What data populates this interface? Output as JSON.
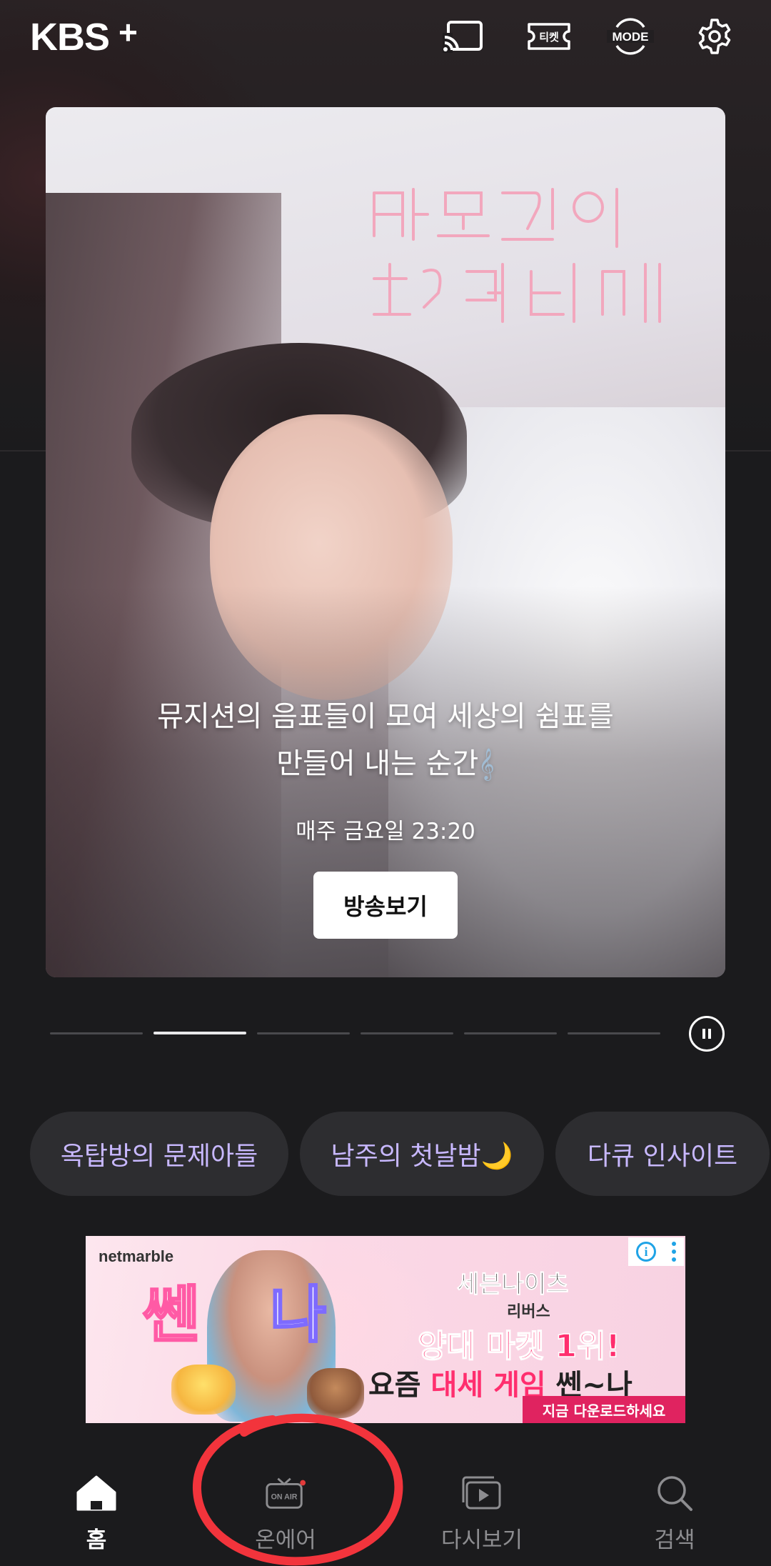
{
  "header": {
    "logo_text": "KBS",
    "logo_plus": "+",
    "icons": [
      "cast-icon",
      "ticket-icon",
      "mode-icon",
      "settings-icon"
    ],
    "ticket_label": "티켓",
    "mode_label": "MODE"
  },
  "hero": {
    "description_line1": "뮤지션의 음표들이 모여 세상의 쉼표를",
    "description_line2": "만들어 내는 순간",
    "schedule": "매주 금요일 23:20",
    "watch_button": "방송보기",
    "slide_count": 6,
    "active_slide": 2
  },
  "chips": [
    {
      "label": "옥탑방의 문제아들"
    },
    {
      "label": "남주의 첫날밤🌙"
    },
    {
      "label": "다큐 인사이트"
    }
  ],
  "ad": {
    "brand": "netmarble",
    "title": "세븐나이츠",
    "subtitle": "리버스",
    "rank_text": "양대 마켓 1위!",
    "slogan_prefix": "요즘",
    "slogan_highlight": "대세 게임",
    "slogan_suffix": "쎈~나",
    "cta": "지금 다운로드하세요",
    "info_icon": "info-icon"
  },
  "bottom_nav": [
    {
      "label": "홈",
      "icon": "home-icon",
      "active": true
    },
    {
      "label": "온에어",
      "icon": "on-air-icon",
      "active": false
    },
    {
      "label": "다시보기",
      "icon": "replay-icon",
      "active": false
    },
    {
      "label": "검색",
      "icon": "search-icon",
      "active": false
    }
  ],
  "colors": {
    "background": "#1b1b1d",
    "chip_bg": "#2d2d30",
    "chip_text": "#c8b8ff",
    "nav_inactive": "#8d8d90",
    "annotation": "#f2343c"
  }
}
